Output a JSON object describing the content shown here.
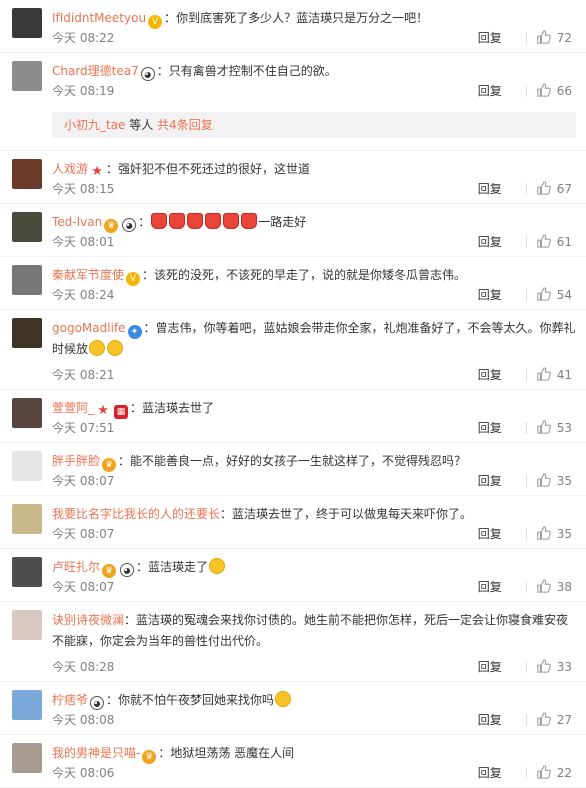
{
  "reply_label": "回复",
  "colors": {
    "username": "#eb7350",
    "meta": "#808080",
    "background": "#ffffff"
  },
  "comments": [
    {
      "user": "IfIdidntMeetyou",
      "badges": [
        "vip"
      ],
      "text": "你到底害死了多少人？蓝洁瑛只是万分之一吧！",
      "time": "今天 08:22",
      "likes": "72",
      "avatar": "#3a3a3a"
    },
    {
      "user": "Chard理德tea7",
      "badges": [
        "panda"
      ],
      "text": "只有禽兽才控制不住自己的欲。",
      "time": "今天 08:19",
      "likes": "66",
      "avatar": "#8c8c8c",
      "sub_reply": {
        "name": "小初九_tae",
        "text": "等人",
        "count": "共4条回复"
      }
    },
    {
      "user": "人戏游",
      "badges": [
        "star"
      ],
      "text": "强奸犯不但不死还过的很好，这世道",
      "time": "今天 08:15",
      "likes": "67",
      "avatar": "#6b3a2a"
    },
    {
      "user": "Ted-Ivan",
      "badges": [
        "gold",
        "panda"
      ],
      "text": "一路走好",
      "emojis": [
        "red",
        "red",
        "red",
        "red",
        "red",
        "red"
      ],
      "time": "今天 08:01",
      "likes": "61",
      "avatar": "#4a4a3a"
    },
    {
      "user": "秦献军节度使",
      "badges": [
        "vip"
      ],
      "text": "该死的没死，不该死的早走了，说的就是你矮冬瓜曾志伟。",
      "time": "今天 08:24",
      "likes": "54",
      "avatar": "#777777"
    },
    {
      "user": "gogoMadlife",
      "badges": [
        "blue"
      ],
      "text": "曾志伟，你等着吧，蓝姑娘会带走你全家，礼炮准备好了，不会等太久。你葬礼时候放",
      "emojis": [
        "yellow",
        "yellow"
      ],
      "time": "今天 08:21",
      "likes": "41",
      "avatar": "#3f3526"
    },
    {
      "user": "萱萱阿_",
      "badges": [
        "star",
        "red"
      ],
      "text": "蓝洁瑛去世了",
      "time": "今天 07:51",
      "likes": "53",
      "avatar": "#5a4640"
    },
    {
      "user": "胖手胖脸",
      "badges": [
        "gold"
      ],
      "text": "能不能善良一点，好好的女孩子一生就这样了，不觉得残忍吗？",
      "time": "今天 08:07",
      "likes": "35",
      "avatar": "#e6e6e6"
    },
    {
      "user": "我要比名字比我长的人的还要长",
      "badges": [],
      "text": "蓝洁瑛去世了，终于可以做鬼每天来吓你了。",
      "time": "今天 08:07",
      "likes": "35",
      "avatar": "#c9b98a"
    },
    {
      "user": "卢旺扎尔",
      "badges": [
        "gold",
        "panda"
      ],
      "text": "蓝洁瑛走了",
      "emojis": [
        "yellow"
      ],
      "time": "今天 08:07",
      "likes": "38",
      "avatar": "#4d4d4d"
    },
    {
      "user": "诀别诗夜微澜",
      "badges": [],
      "text": "蓝洁瑛的冤魂会来找你讨债的。她生前不能把你怎样，死后一定会让你寝食难安夜不能寐，你定会为当年的兽性付出代价。",
      "time": "今天 08:28",
      "likes": "33",
      "avatar": "#d9c7c2"
    },
    {
      "user": "柠痞爷",
      "badges": [
        "panda"
      ],
      "text": "你就不怕午夜梦回她来找你吗",
      "emojis": [
        "yellow"
      ],
      "time": "今天 08:08",
      "likes": "27",
      "avatar": "#7aa8d8"
    },
    {
      "user": "我的男神是只喵-",
      "badges": [
        "gold"
      ],
      "text": "地狱坦荡荡 恶魔在人间",
      "time": "今天 08:06",
      "likes": "22",
      "avatar": "#a89c90"
    }
  ]
}
